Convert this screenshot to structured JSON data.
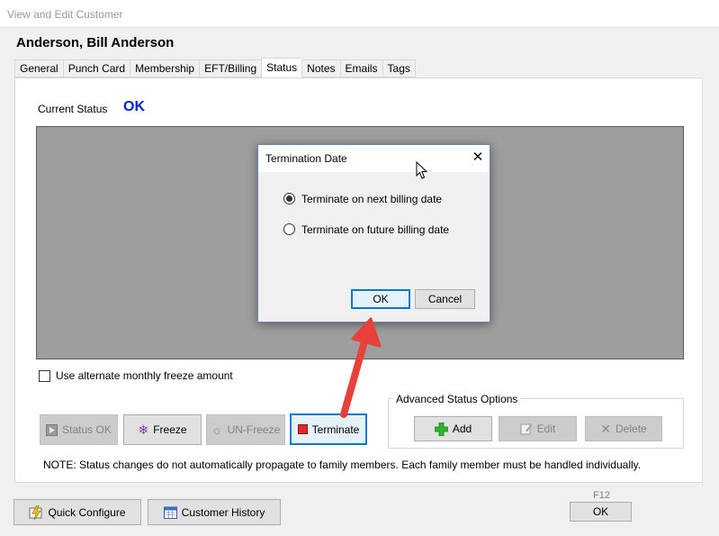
{
  "window": {
    "title": "View and Edit Customer"
  },
  "customer": {
    "name": "Anderson, Bill Anderson"
  },
  "tabs": [
    {
      "label": "General"
    },
    {
      "label": "Punch Card"
    },
    {
      "label": "Membership"
    },
    {
      "label": "EFT/Billing"
    },
    {
      "label": "Status",
      "active": true
    },
    {
      "label": "Notes"
    },
    {
      "label": "Emails"
    },
    {
      "label": "Tags"
    }
  ],
  "status": {
    "label": "Current Status",
    "value": "OK",
    "value_color": "#0020d6"
  },
  "freeze_option": {
    "label": "Use alternate monthly freeze amount",
    "checked": false
  },
  "actions": {
    "status_ok": {
      "label": "Status OK",
      "enabled": false
    },
    "freeze": {
      "label": "Freeze",
      "enabled": true
    },
    "unfreeze": {
      "label": "UN-Freeze",
      "enabled": false
    },
    "terminate": {
      "label": "Terminate",
      "enabled": true
    }
  },
  "advanced": {
    "title": "Advanced Status Options",
    "add": {
      "label": "Add",
      "enabled": true
    },
    "edit": {
      "label": "Edit",
      "enabled": false
    },
    "delete": {
      "label": "Delete",
      "enabled": false
    }
  },
  "note": "NOTE:  Status changes do not automatically propagate to family members.  Each family member must be handled individually.",
  "footer": {
    "quick_configure": "Quick Configure",
    "customer_history": "Customer History",
    "ok_shortcut": "F12",
    "ok": "OK"
  },
  "dialog": {
    "title": "Termination Date",
    "options": [
      {
        "label": "Terminate on next billing date",
        "selected": true
      },
      {
        "label": "Terminate on future billing date",
        "selected": false
      }
    ],
    "ok": "OK",
    "cancel": "Cancel"
  },
  "annotation": {
    "arrow_color": "#e8403a"
  }
}
